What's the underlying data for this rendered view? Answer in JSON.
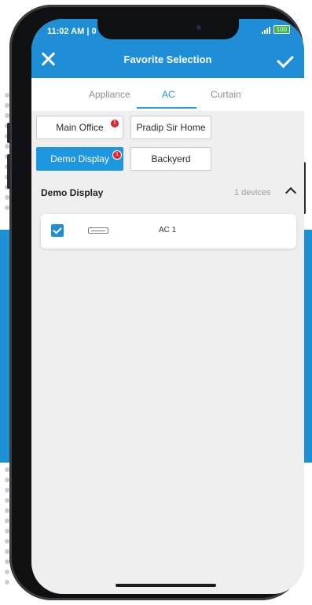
{
  "status_bar": {
    "time": "11:02 AM",
    "time_suffix": "| 0",
    "battery": "100"
  },
  "header": {
    "title": "Favorite Selection"
  },
  "tabs": [
    {
      "label": "Appliance",
      "active": false
    },
    {
      "label": "AC",
      "active": true
    },
    {
      "label": "Curtain",
      "active": false
    }
  ],
  "rooms": [
    {
      "label": "Main Office",
      "badge": "1",
      "active": false
    },
    {
      "label": "Pradip Sir Home",
      "active": false
    },
    {
      "label": "Demo Display",
      "badge": "1",
      "active": true
    },
    {
      "label": "Backyerd",
      "active": false
    }
  ],
  "group": {
    "title": "Demo Display",
    "count": "1 devices"
  },
  "devices": [
    {
      "name": "AC 1",
      "checked": true,
      "icon": "ac-unit-icon"
    }
  ],
  "colors": {
    "primary": "#1e8fd6",
    "badge": "#e0232a",
    "screen_bg": "#efefef"
  }
}
